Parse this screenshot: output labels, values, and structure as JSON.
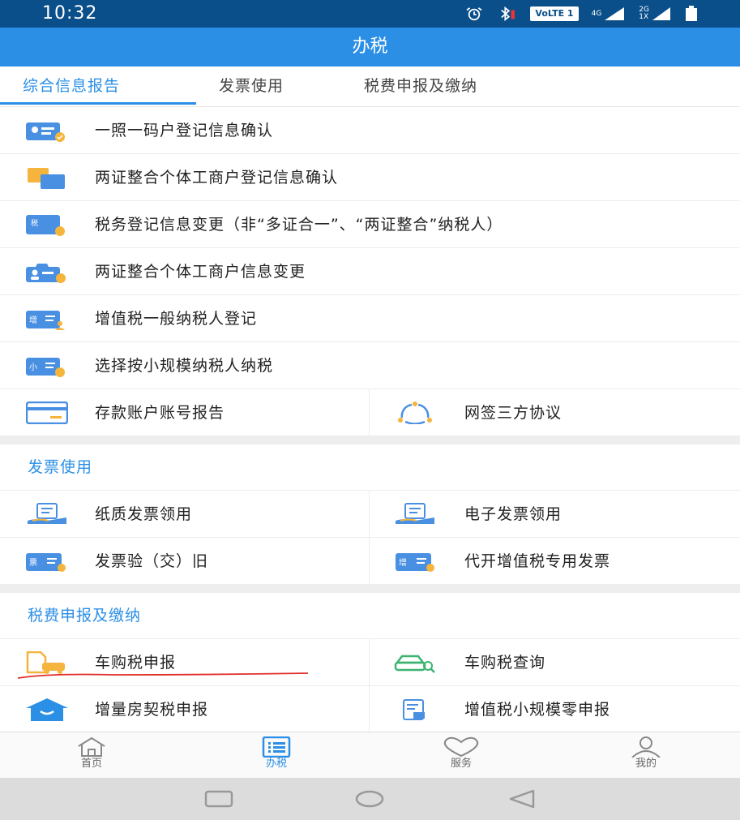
{
  "status_bar": {
    "time": "10:32",
    "volte": "VoLTE 1",
    "net1": "4G",
    "net2_top": "2G",
    "net2_bottom": "1X",
    "icons": [
      "alarm-icon",
      "bluetooth-icon",
      "signal-icon",
      "battery-icon"
    ]
  },
  "header": {
    "title": "办税"
  },
  "tabs": [
    {
      "label": "综合信息报告",
      "active": true
    },
    {
      "label": "发票使用",
      "active": false
    },
    {
      "label": "税费申报及缴纳",
      "active": false
    }
  ],
  "info_items": [
    {
      "label": "一照一码户登记信息确认",
      "icon": "id-card-check-icon"
    },
    {
      "label": "两证整合个体工商户登记信息确认",
      "icon": "documents-icon"
    },
    {
      "label": "税务登记信息变更（非“多证合一”、“两证整合”纳税人）",
      "icon": "tax-card-icon"
    },
    {
      "label": "两证整合个体工商户信息变更",
      "icon": "shop-user-icon"
    },
    {
      "label": "增值税一般纳税人登记",
      "icon": "vat-user-icon"
    },
    {
      "label": "选择按小规模纳税人纳税",
      "icon": "small-scale-icon"
    }
  ],
  "info_pair": [
    {
      "label": "存款账户账号报告",
      "icon": "bank-card-icon"
    },
    {
      "label": "网签三方协议",
      "icon": "tripartite-icon"
    }
  ],
  "invoice_section": {
    "title": "发票使用",
    "items": [
      {
        "label": "纸质发票领用",
        "icon": "hand-invoice-icon"
      },
      {
        "label": "电子发票领用",
        "icon": "hand-invoice-icon"
      },
      {
        "label": "发票验（交）旧",
        "icon": "invoice-check-icon"
      },
      {
        "label": "代开增值税专用发票",
        "icon": "vat-invoice-icon"
      }
    ]
  },
  "declare_section": {
    "title": "税费申报及缴纳",
    "items": [
      {
        "label": "车购税申报",
        "icon": "car-document-icon"
      },
      {
        "label": "车购税查询",
        "icon": "car-search-icon"
      },
      {
        "label": "增量房契税申报",
        "icon": "house-icon"
      },
      {
        "label": "增值税小规模零申报",
        "icon": "zero-declare-icon"
      }
    ]
  },
  "bottom_nav": [
    {
      "label": "首页",
      "icon": "home-icon",
      "active": false
    },
    {
      "label": "办税",
      "icon": "list-icon",
      "active": true
    },
    {
      "label": "服务",
      "icon": "heart-icon",
      "active": false
    },
    {
      "label": "我的",
      "icon": "user-icon",
      "active": false
    }
  ],
  "system_nav": [
    "recent-apps-icon",
    "home-circle-icon",
    "back-triangle-icon"
  ],
  "colors": {
    "primary": "#2b8fe6",
    "status_bar": "#0a4e8a",
    "icon_orange": "#f5b43c",
    "icon_green": "#3cb371",
    "annotation_red": "#e0302c"
  }
}
